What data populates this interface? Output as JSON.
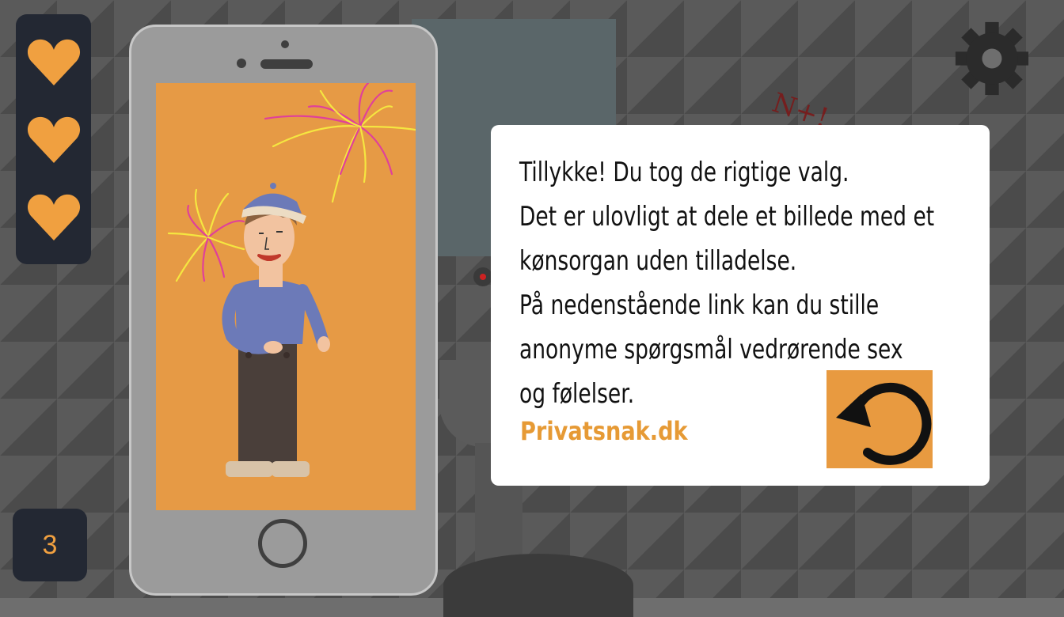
{
  "lives": {
    "count": 3,
    "heart_color": "#F0A040",
    "icons": [
      "heart-icon",
      "heart-icon",
      "heart-icon"
    ]
  },
  "level": {
    "number": "3"
  },
  "settings": {
    "icon": "gear-icon"
  },
  "background": {
    "graffiti": "N+!"
  },
  "dialog": {
    "lines": [
      "Tillykke! Du tog de rigtige valg.",
      "Det er ulovligt at dele et billede med et",
      "kønsorgan uden tilladelse.",
      "På nedenstående link kan du stille",
      "anonyme spørgsmål vedrørende sex",
      "og følelser."
    ],
    "link_text": "Privatsnak.dk",
    "replay_icon": "replay-icon"
  },
  "colors": {
    "accent": "#E89A40",
    "panel": "#232833",
    "screen": "#E69A45"
  }
}
